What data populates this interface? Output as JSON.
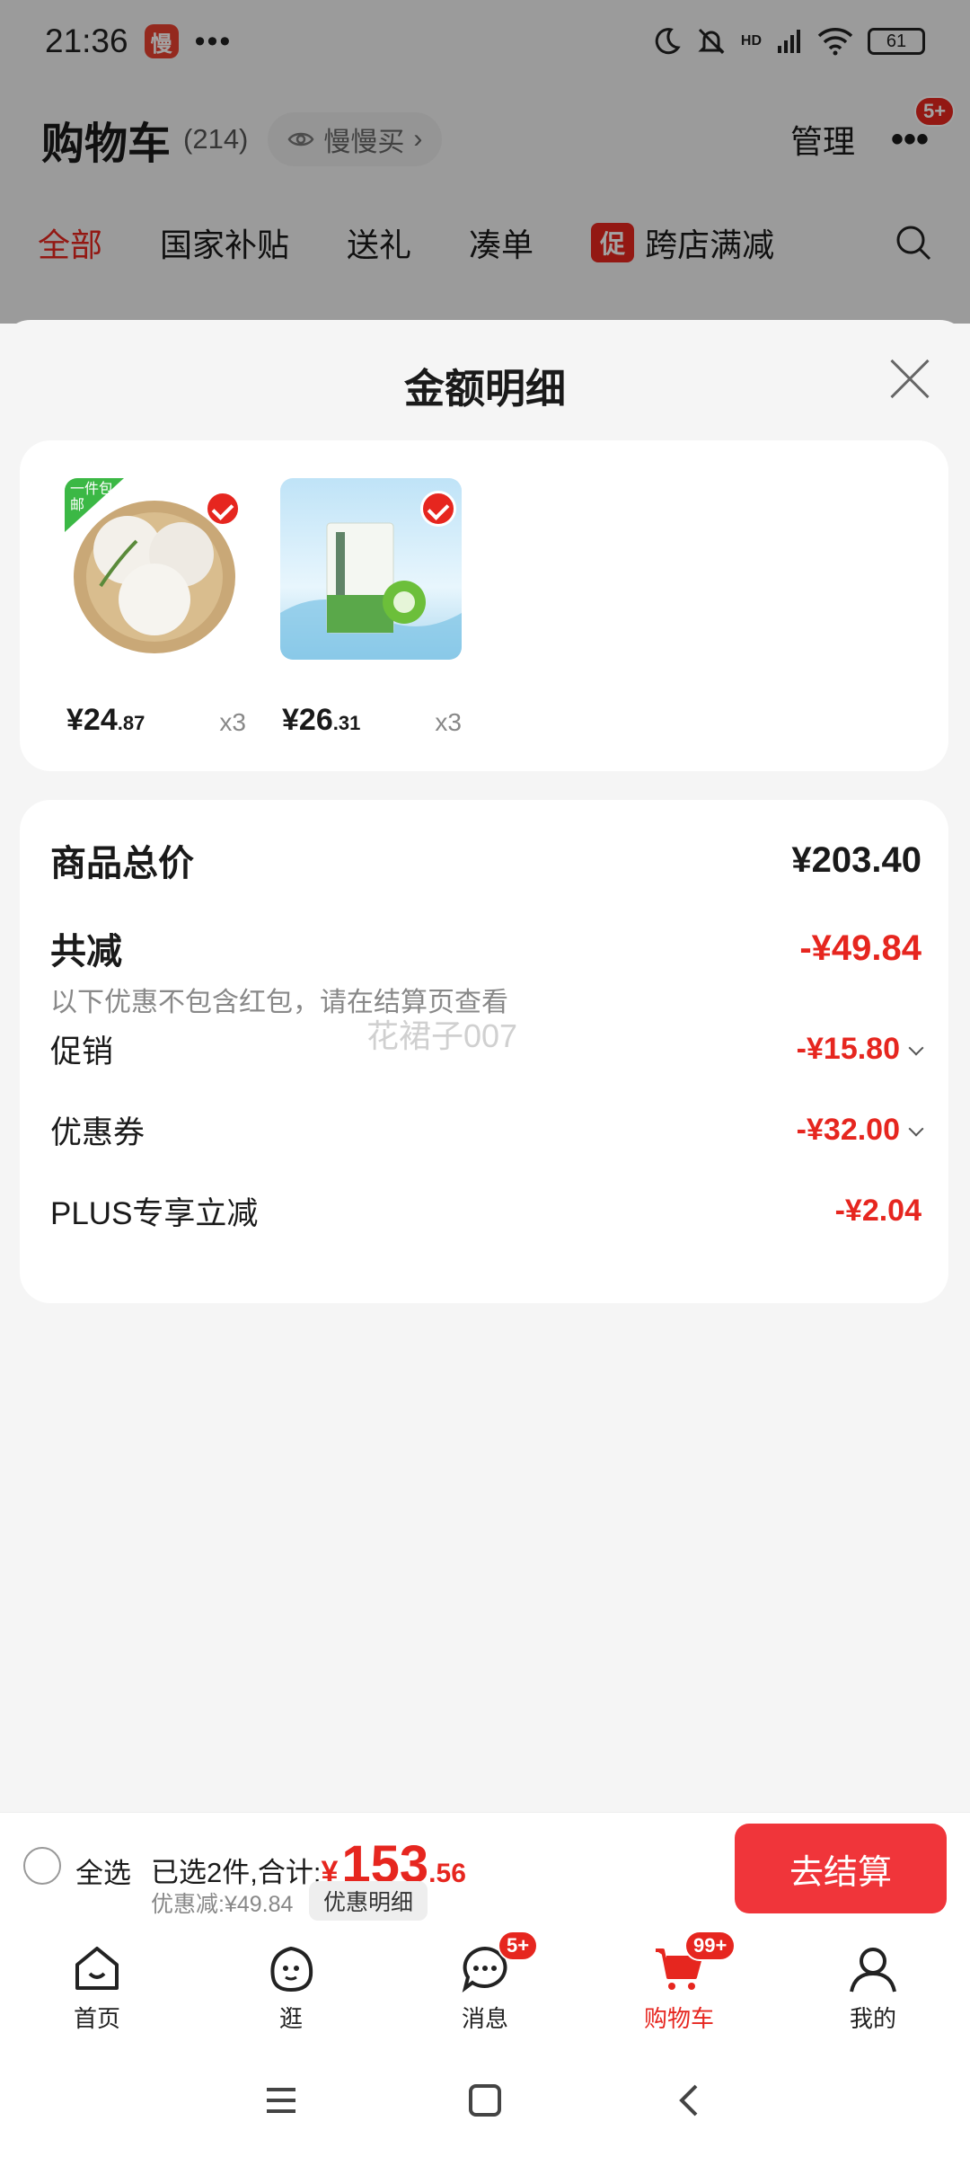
{
  "status_bar": {
    "time": "21:36",
    "app_badge": "慢",
    "dots": "•••",
    "battery": "61",
    "network": "HD"
  },
  "cart_header": {
    "title": "购物车",
    "count": "(214)",
    "slow_buy": "慢慢买",
    "manage": "管理",
    "more_badge": "5+"
  },
  "filter_tabs": [
    {
      "label": "全部",
      "active": true
    },
    {
      "label": "国家补贴"
    },
    {
      "label": "送礼"
    },
    {
      "label": "凑单"
    },
    {
      "label": "跨店满减",
      "tag": "促"
    }
  ],
  "sheet": {
    "title": "金额明细"
  },
  "products": [
    {
      "price_int": "¥24",
      "price_dec": ".87",
      "qty": "x3",
      "tag": "一件包邮",
      "icon": "coconut-image"
    },
    {
      "price_int": "¥26",
      "price_dec": ".31",
      "qty": "x3",
      "icon": "coconut-water-box-image"
    }
  ],
  "amounts": {
    "total_label": "商品总价",
    "total_value": "¥203.40",
    "reduce_label": "共减",
    "reduce_value": "-¥49.84",
    "note": "以下优惠不包含红包，请在结算页查看",
    "items": [
      {
        "label": "促销",
        "value": "-¥15.80",
        "expand": true
      },
      {
        "label": "优惠券",
        "value": "-¥32.00",
        "expand": true
      },
      {
        "label": "PLUS专享立减",
        "value": "-¥2.04",
        "expand": false
      }
    ]
  },
  "watermark": "花裙子007",
  "checkout": {
    "select_all": "全选",
    "summary_label": "已选2件,合计:",
    "currency": "¥",
    "total_int": "153",
    "total_dec": ".56",
    "saved": "优惠减:¥49.84",
    "detail": "优惠明细",
    "pay": "去结算"
  },
  "bottom_nav": [
    {
      "label": "首页",
      "icon": "home-icon"
    },
    {
      "label": "逛",
      "icon": "browse-icon"
    },
    {
      "label": "消息",
      "icon": "message-icon",
      "badge": "5+"
    },
    {
      "label": "购物车",
      "icon": "cart-icon",
      "badge": "99+",
      "active": true
    },
    {
      "label": "我的",
      "icon": "profile-icon"
    }
  ],
  "colors": {
    "accent": "#e6261f",
    "pay_button": "#f0353a",
    "background": "#f5f5f5"
  }
}
